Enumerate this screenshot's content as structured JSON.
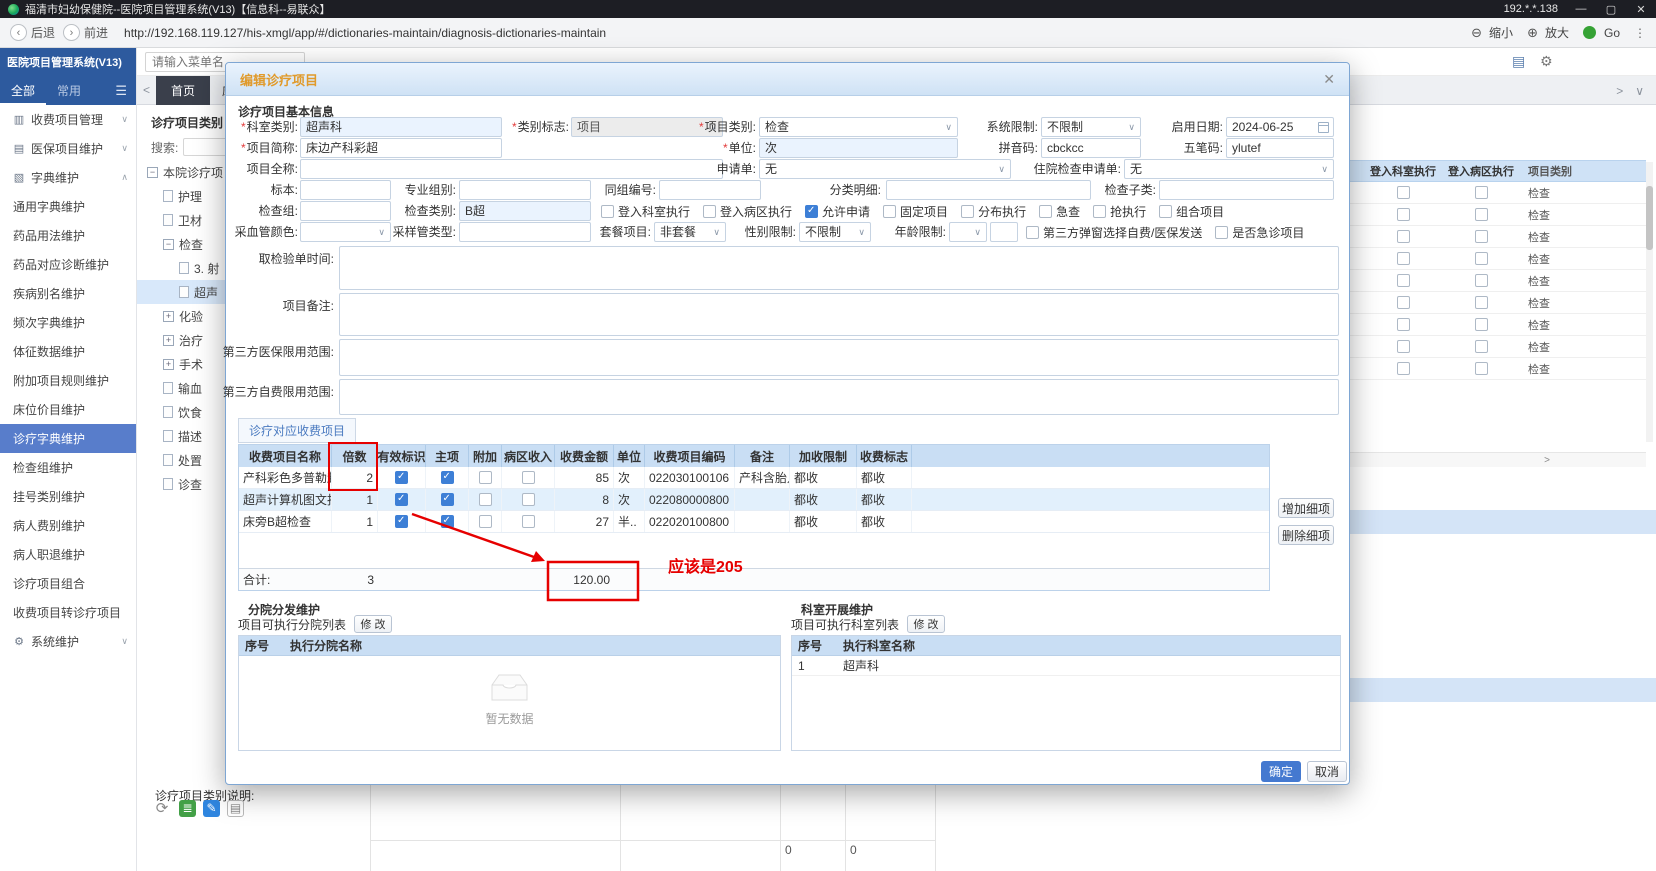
{
  "titlebar": {
    "title": "福清市妇幼保健院--医院项目管理系统(V13)【信息科--易联众】",
    "ip": "192.*.*.138"
  },
  "navbar": {
    "back": "后退",
    "forward": "前进",
    "url": "http://192.168.119.127/his-xmgl/app/#/dictionaries-maintain/diagnosis-dictionaries-maintain",
    "zoom_out": "缩小",
    "zoom_in": "放大",
    "go": "Go"
  },
  "topbar": {
    "search_placeholder": "请输入菜单名..."
  },
  "tabbar": {
    "tabs": [
      {
        "label": "首页"
      },
      {
        "label": "床位价.."
      }
    ]
  },
  "sidebar": {
    "title": "医院项目管理系统(V13)",
    "tabs": [
      {
        "label": "全部"
      },
      {
        "label": "常用"
      }
    ],
    "items": [
      {
        "label": "收费项目管理"
      },
      {
        "label": "医保项目维护"
      },
      {
        "label": "字典维护"
      },
      {
        "label": "通用字典维护"
      },
      {
        "label": "药品用法维护"
      },
      {
        "label": "药品对应诊断维护"
      },
      {
        "label": "疾病别名维护"
      },
      {
        "label": "频次字典维护"
      },
      {
        "label": "体征数据维护"
      },
      {
        "label": "附加项目规则维护"
      },
      {
        "label": "床位价目维护"
      },
      {
        "label": "诊疗字典维护"
      },
      {
        "label": "检查组维护"
      },
      {
        "label": "挂号类别维护"
      },
      {
        "label": "病人费别维护"
      },
      {
        "label": "病人职退维护"
      },
      {
        "label": "诊疗项目组合"
      },
      {
        "label": "收费项目转诊疗项目"
      },
      {
        "label": "系统维护"
      }
    ]
  },
  "tree_panel": {
    "title": "诊疗项目类别",
    "search_label": "搜索:",
    "nodes": [
      {
        "label": "本院诊疗项"
      },
      {
        "label": "护理"
      },
      {
        "label": "卫材"
      },
      {
        "label": "检查"
      },
      {
        "label": "3. 射"
      },
      {
        "label": "超声"
      },
      {
        "label": "化验"
      },
      {
        "label": "治疗"
      },
      {
        "label": "手术"
      },
      {
        "label": "输血"
      },
      {
        "label": "饮食"
      },
      {
        "label": "描述"
      },
      {
        "label": "处置"
      },
      {
        "label": "诊查"
      }
    ]
  },
  "bg_table": {
    "headers": [
      "登入科室执行",
      "登入病区执行",
      "项目类别"
    ],
    "row_value": "检查",
    "bottom_values": [
      "0",
      "0"
    ]
  },
  "bottom_bar": {
    "note_label": "诊疗项目类别说明:"
  },
  "modal": {
    "title": "编辑诊疗项目",
    "sections": {
      "basic": "诊疗项目基本信息",
      "fee_tab": "诊疗对应收费项目",
      "branch": "分院分发维护",
      "dept": "科室开展维护"
    },
    "fields": {
      "dept_category": {
        "label": "科室类别:",
        "value": "超声科"
      },
      "category_flag": {
        "label": "类别标志:",
        "value": "项目"
      },
      "item_category": {
        "label": "项目类别:",
        "value": "检查"
      },
      "system_limit": {
        "label": "系统限制:",
        "value": "不限制"
      },
      "start_date": {
        "label": "启用日期:",
        "value": "2024-06-25"
      },
      "short_name": {
        "label": "项目简称:",
        "value": "床边产科彩超"
      },
      "unit": {
        "label": "单位:",
        "value": "次"
      },
      "pinyin": {
        "label": "拼音码:",
        "value": "cbckcc"
      },
      "wubi": {
        "label": "五笔码:",
        "value": "ylutef"
      },
      "full_name": {
        "label": "项目全称:",
        "value": ""
      },
      "apply_form": {
        "label": "申请单:",
        "value": "无"
      },
      "inpatient_apply": {
        "label": "住院检查申请单:",
        "value": "无"
      },
      "specimen": {
        "label": "标本:",
        "value": ""
      },
      "prof_group": {
        "label": "专业组别:",
        "value": ""
      },
      "group_no": {
        "label": "同组编号:",
        "value": ""
      },
      "class_detail": {
        "label": "分类明细:",
        "value": ""
      },
      "check_subclass": {
        "label": "检查子类:",
        "value": ""
      },
      "check_group": {
        "label": "检查组:",
        "value": ""
      },
      "check_category": {
        "label": "检查类别:",
        "value": "B超"
      },
      "blood_tube_color": {
        "label": "采血管颜色:",
        "value": ""
      },
      "sample_tube_type": {
        "label": "采样管类型:",
        "value": ""
      },
      "package_item": {
        "label": "套餐项目:",
        "value": "非套餐"
      },
      "gender_limit": {
        "label": "性别限制:",
        "value": "不限制"
      },
      "age_limit": {
        "label": "年龄限制:",
        "value": ""
      },
      "lab_time": {
        "label": "取检验单时间:",
        "value": ""
      },
      "remark": {
        "label": "项目备注:",
        "value": ""
      },
      "third_insurance_range": {
        "label": "第三方医保限用范围:",
        "value": ""
      },
      "third_self_range": {
        "label": "第三方自费限用范围:",
        "value": ""
      }
    },
    "checkboxes": [
      {
        "label": "登入科室执行",
        "checked": false
      },
      {
        "label": "登入病区执行",
        "checked": false
      },
      {
        "label": "允许申请",
        "checked": true
      },
      {
        "label": "固定项目",
        "checked": false
      },
      {
        "label": "分布执行",
        "checked": false
      },
      {
        "label": "急查",
        "checked": false
      },
      {
        "label": "抢执行",
        "checked": false
      },
      {
        "label": "组合项目",
        "checked": false
      }
    ],
    "checkboxes2": [
      {
        "label": "第三方弹窗选择自费/医保发送",
        "checked": false
      },
      {
        "label": "是否急诊项目",
        "checked": false
      }
    ],
    "fee_table": {
      "headers": [
        "收费项目名称",
        "倍数",
        "有效标识",
        "主项",
        "附加",
        "病区收入",
        "收费金额",
        "单位",
        "收费项目编码",
        "备注",
        "加收限制",
        "收费标志"
      ],
      "rows": [
        {
          "name": "产科彩色多普勒超声..",
          "multiple": "2",
          "valid": true,
          "main": true,
          "extra": false,
          "ward": false,
          "amount": "85",
          "unit": "次",
          "code": "022030100106",
          "note": "产科含胎儿..",
          "surcharge": "都收",
          "flag": "都收"
        },
        {
          "name": "超声计算机图文报告",
          "multiple": "1",
          "valid": true,
          "main": true,
          "extra": false,
          "ward": false,
          "amount": "8",
          "unit": "次",
          "code": "022080000800",
          "note": "",
          "surcharge": "都收",
          "flag": "都收"
        },
        {
          "name": "床旁B超检查",
          "multiple": "1",
          "valid": true,
          "main": true,
          "extra": false,
          "ward": false,
          "amount": "27",
          "unit": "半..",
          "code": "022020100800",
          "note": "",
          "surcharge": "都收",
          "flag": "都收"
        }
      ],
      "total_label": "合计:",
      "total_multiple": "3",
      "total_amount": "120.00"
    },
    "buttons": {
      "add_item": "增加细项",
      "remove_item": "删除细项",
      "modify": "修 改",
      "ok": "确定",
      "cancel": "取消"
    },
    "branch": {
      "list_label": "项目可执行分院列表",
      "headers": [
        "序号",
        "执行分院名称"
      ],
      "empty_text": "暂无数据"
    },
    "dept": {
      "list_label": "项目可执行科室列表",
      "headers": [
        "序号",
        "执行科室名称"
      ],
      "rows": [
        {
          "no": "1",
          "name": "超声科"
        }
      ]
    }
  },
  "annotation": {
    "text": "应该是205"
  },
  "icons": {
    "minimize": "—",
    "maximize": "▢",
    "close": "✕",
    "back_glyph": "‹",
    "forward_glyph": "›",
    "zoom_out": "⊖",
    "zoom_in": "⊕",
    "dots": "⋮",
    "hamburger": "☰",
    "caret_down": "∨",
    "caret_up": "∧",
    "chev_left": "<",
    "chev_right": ">",
    "gear": "⚙",
    "book": "▤",
    "menu_billing": "▥",
    "menu_insurance": "▤",
    "menu_dict": "▧",
    "menu_system": "⚙",
    "refresh": "⟳",
    "edit": "✎",
    "lines": "≣",
    "doc": "▤",
    "modal_close": "✕"
  }
}
